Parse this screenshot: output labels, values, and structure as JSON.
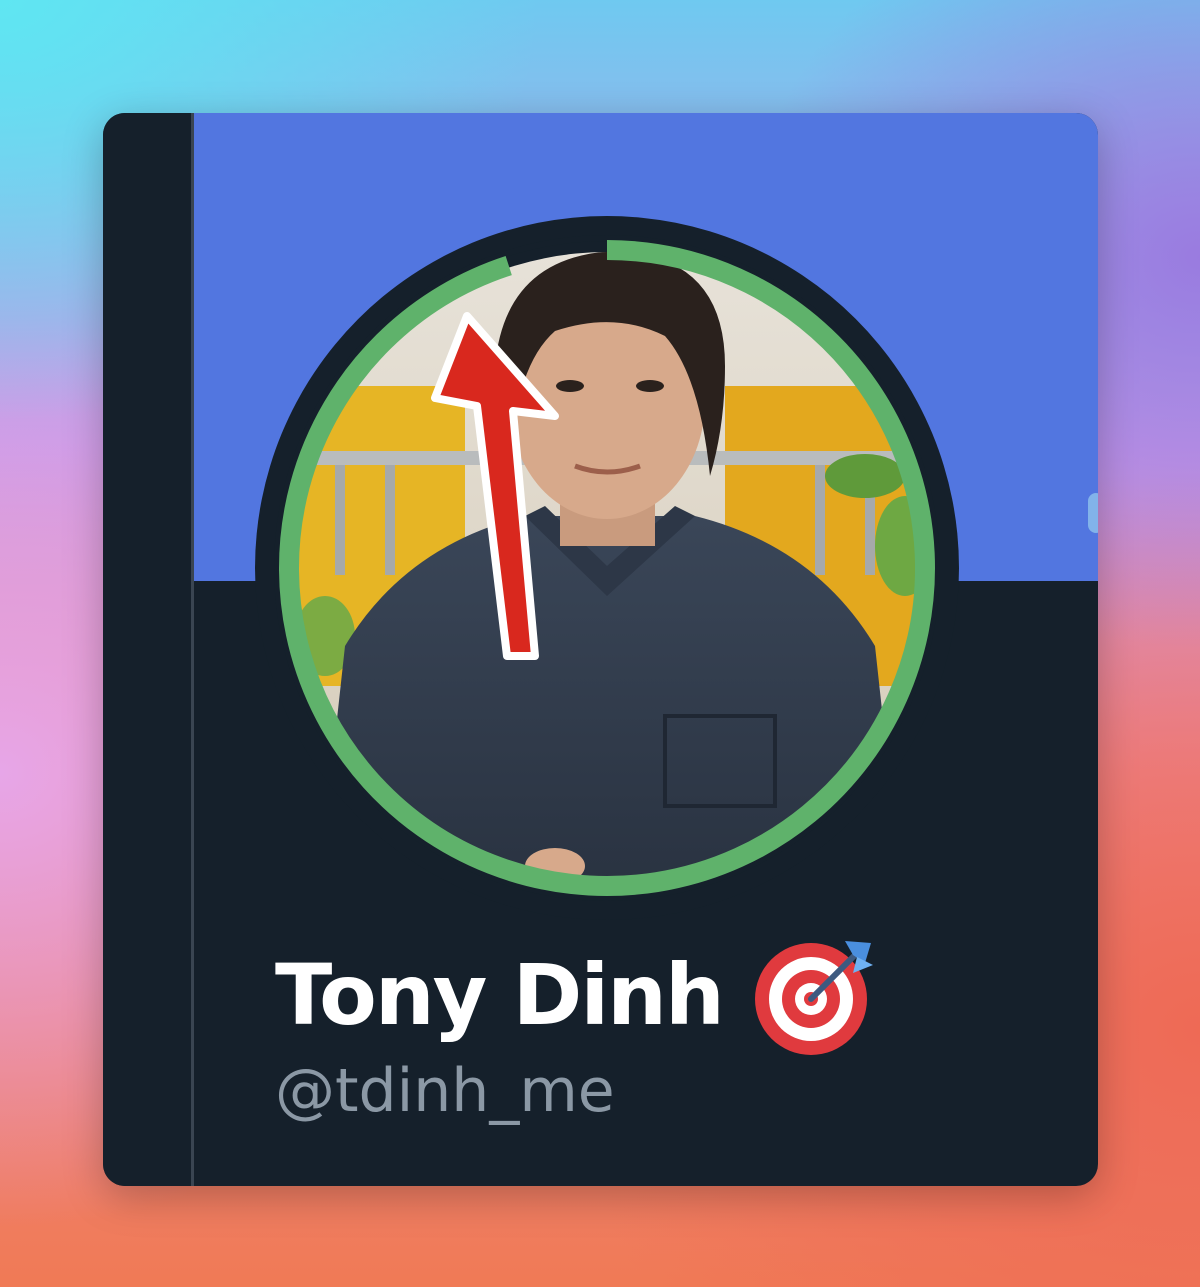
{
  "profile": {
    "display_name": "Tony Dinh",
    "handle": "@tdinh_me",
    "badge_icon": "direct-hit-target-icon",
    "avatar_description_icon": "profile-photo"
  },
  "progress_ring": {
    "fraction": 0.95,
    "color": "#5fb26b"
  },
  "annotation": {
    "icon": "red-arrow-up-icon",
    "color": "#d9281e"
  },
  "colors": {
    "banner": "#5276e0",
    "card": "#15202b",
    "name": "#ffffff",
    "handle": "#8b98a5"
  }
}
